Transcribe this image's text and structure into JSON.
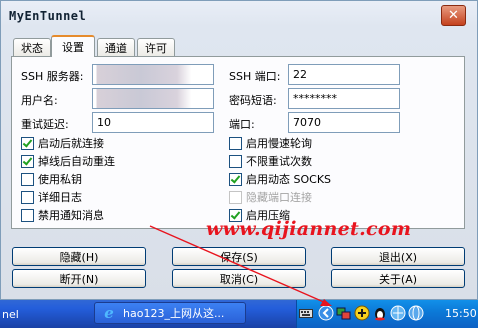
{
  "window": {
    "title": "MyEnTunnel",
    "close_glyph": "✕"
  },
  "tabs": [
    {
      "label": "状态",
      "active": false
    },
    {
      "label": "设置",
      "active": true
    },
    {
      "label": "通道",
      "active": false
    },
    {
      "label": "许可",
      "active": false
    }
  ],
  "fields": {
    "ssh_server": {
      "label": "SSH 服务器:",
      "value": ""
    },
    "username": {
      "label": "用户名:",
      "value": ""
    },
    "retry_delay": {
      "label": "重试延迟:",
      "value": "10"
    },
    "ssh_port": {
      "label": "SSH 端口:",
      "value": "22"
    },
    "passphrase": {
      "label": "密码短语:",
      "value": "********"
    },
    "port": {
      "label": "端口:",
      "value": "7070"
    }
  },
  "checkboxes_left": [
    {
      "label": "启动后就连接",
      "checked": true
    },
    {
      "label": "掉线后自动重连",
      "checked": true
    },
    {
      "label": "使用私钥",
      "checked": false
    },
    {
      "label": "详细日志",
      "checked": false
    },
    {
      "label": "禁用通知消息",
      "checked": false
    }
  ],
  "checkboxes_right": [
    {
      "label": "启用慢速轮询",
      "checked": false,
      "disabled": false
    },
    {
      "label": "不限重试次数",
      "checked": false,
      "disabled": false
    },
    {
      "label": "启用动态 SOCKS",
      "checked": true,
      "disabled": false
    },
    {
      "label": "隐藏端口连接",
      "checked": false,
      "disabled": true
    },
    {
      "label": "启用压缩",
      "checked": true,
      "disabled": false
    }
  ],
  "buttons": {
    "hide": "隐藏(H)",
    "save": "保存(S)",
    "exit": "退出(X)",
    "disconnect": "断开(N)",
    "cancel": "取消(C)",
    "about": "关于(A)"
  },
  "watermark": "www.qijiannet.com",
  "taskbar": {
    "left_label": "nel",
    "task_item": "hao123_上网从这...",
    "tray_icons": [
      "keyboard-icon",
      "chevron-left-icon",
      "network-icon",
      "plus-icon",
      "qq-penguin-icon",
      "globe-icon",
      "globe-alt-icon"
    ],
    "clock": "15:50"
  }
}
